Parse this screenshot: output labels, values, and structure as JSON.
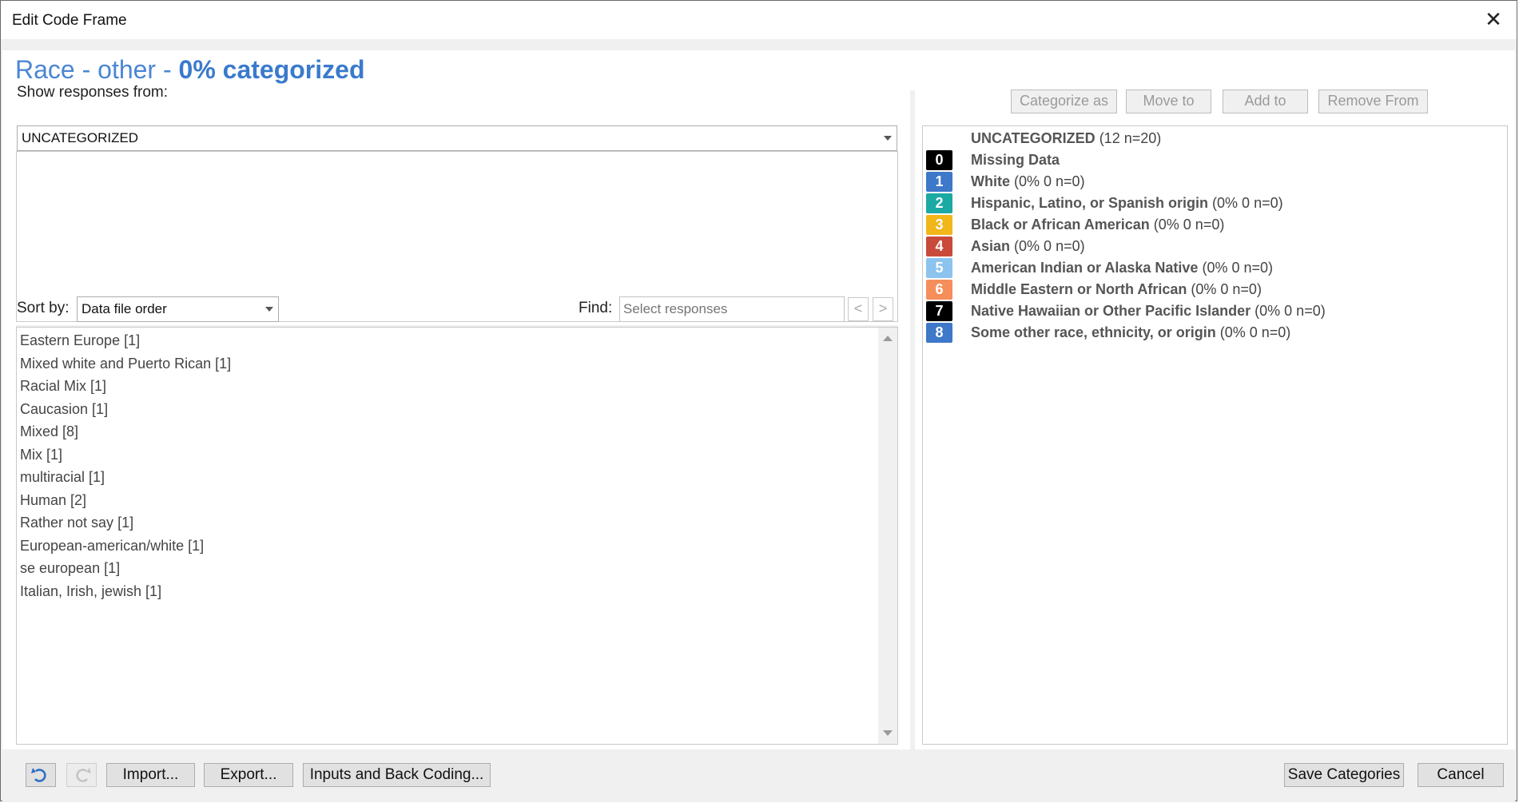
{
  "window": {
    "title": "Edit Code Frame",
    "close_glyph": "✕"
  },
  "heading": {
    "name": "Race - other - ",
    "percent": "0% categorized"
  },
  "filter": {
    "label": "Show responses from:",
    "value": "UNCATEGORIZED"
  },
  "sort": {
    "label": "Sort by:",
    "value": "Data file order"
  },
  "find": {
    "label": "Find:",
    "placeholder": "Select responses",
    "prev": "<",
    "next": ">"
  },
  "responses": [
    "Eastern Europe [1]",
    "Mixed white and Puerto Rican [1]",
    "Racial Mix [1]",
    "Caucasion [1]",
    "Mixed [8]",
    "Mix [1]",
    "multiracial [1]",
    "Human [2]",
    "Rather not say [1]",
    "European-american/white [1]",
    "se european [1]",
    "Italian, Irish, jewish [1]"
  ],
  "actions": {
    "categorize_as": "Categorize as",
    "move_to": "Move to",
    "add_to": "Add to",
    "remove_from": "Remove From"
  },
  "uncategorized": {
    "name": "UNCATEGORIZED",
    "stats": "(12 n=20)"
  },
  "categories": [
    {
      "code": "0",
      "name": "Missing Data",
      "stats": "",
      "color": "#000000"
    },
    {
      "code": "1",
      "name": "White",
      "stats": "(0% 0 n=0)",
      "color": "#3d78c9"
    },
    {
      "code": "2",
      "name": "Hispanic, Latino, or Spanish origin",
      "stats": "(0% 0 n=0)",
      "color": "#1aa9a3"
    },
    {
      "code": "3",
      "name": "Black or African American",
      "stats": "(0% 0 n=0)",
      "color": "#f1b619"
    },
    {
      "code": "4",
      "name": "Asian",
      "stats": "(0% 0 n=0)",
      "color": "#c94a3a"
    },
    {
      "code": "5",
      "name": "American Indian or Alaska Native",
      "stats": "(0% 0 n=0)",
      "color": "#8cc3ef"
    },
    {
      "code": "6",
      "name": "Middle Eastern or North African",
      "stats": "(0% 0 n=0)",
      "color": "#f58e5b"
    },
    {
      "code": "7",
      "name": "Native Hawaiian or Other Pacific Islander",
      "stats": "(0% 0 n=0)",
      "color": "#000000"
    },
    {
      "code": "8",
      "name": "Some other race, ethnicity, or origin",
      "stats": "(0% 0 n=0)",
      "color": "#3d78c9"
    }
  ],
  "footer": {
    "import": "Import...",
    "export": "Export...",
    "inputs": "Inputs and Back Coding...",
    "save": "Save Categories",
    "cancel": "Cancel"
  },
  "colors": {
    "heading": "#4a86d4",
    "undo_icon": "#2f6fc4"
  }
}
